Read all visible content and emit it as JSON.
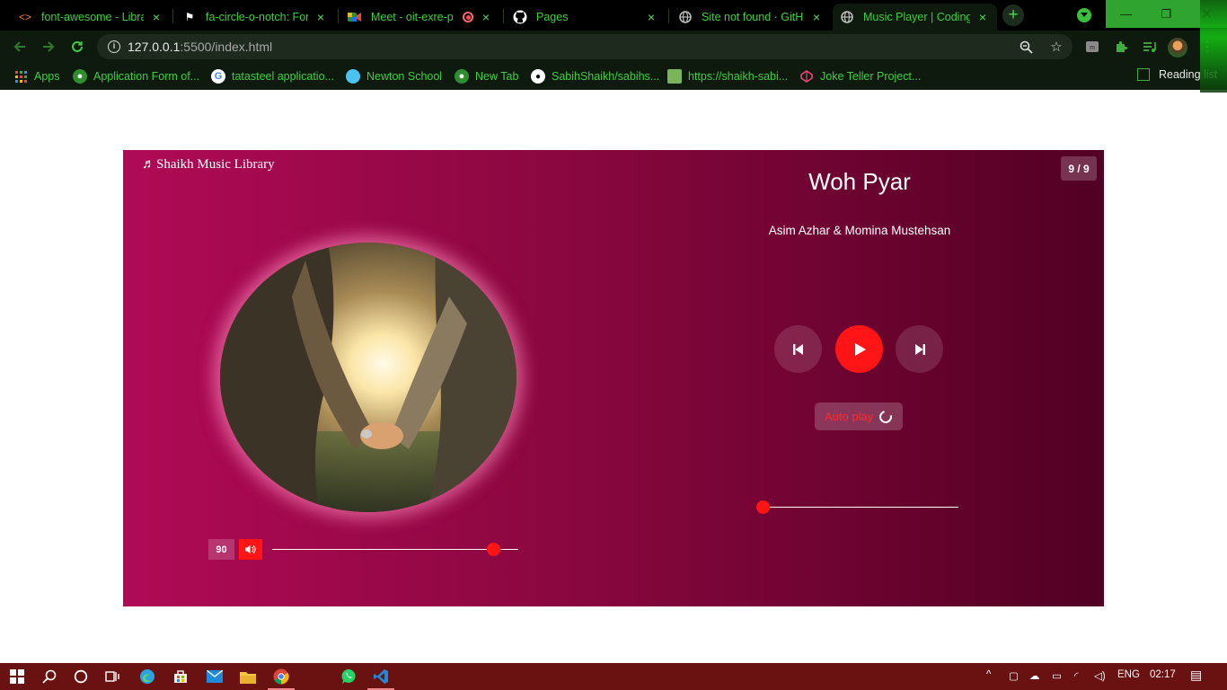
{
  "browser": {
    "tabs": [
      {
        "title": "font-awesome - Librar",
        "icon": "code-icon",
        "close": "×"
      },
      {
        "title": "fa-circle-o-notch: Font",
        "icon": "flag-icon",
        "close": "×"
      },
      {
        "title": "Meet - oit-exre-p",
        "icon": "meet-icon",
        "close": "×"
      },
      {
        "title": "Pages",
        "icon": "github-icon",
        "close": "×"
      },
      {
        "title": "Site not found · GitHub",
        "icon": "globe-icon",
        "close": "×"
      },
      {
        "title": "Music Player | Coding",
        "icon": "globe-icon",
        "close": "×"
      }
    ],
    "new_tab": "+",
    "url_host": "127.0.0.1",
    "url_rest": ":5500/index.html",
    "bookmarks": [
      {
        "label": "Apps",
        "icon": "apps-grid-icon"
      },
      {
        "label": "Application Form of...",
        "icon": "globe-icon"
      },
      {
        "label": "tatasteel applicatio...",
        "icon": "google-icon"
      },
      {
        "label": "Newton School",
        "icon": "newton-icon"
      },
      {
        "label": "New Tab",
        "icon": "globe-icon"
      },
      {
        "label": "SabihShaikh/sabihs...",
        "icon": "github-icon"
      },
      {
        "label": "https://shaikh-sabi...",
        "icon": "shopify-icon"
      },
      {
        "label": "Joke Teller Project...",
        "icon": "codepen-icon"
      }
    ],
    "reading_list": "Reading list"
  },
  "player": {
    "library_title": "Shaikh Music Library",
    "track_counter": "9 / 9",
    "song_title": "Woh Pyar",
    "artist": "Asim Azhar & Momina Mustehsan",
    "autoplay_label": "Auto play",
    "volume_value": "90",
    "volume_level": 0.9,
    "seek_progress": 0,
    "accent_color": "#ff1515"
  },
  "taskbar": {
    "language": "ENG",
    "clock": "02:17"
  }
}
